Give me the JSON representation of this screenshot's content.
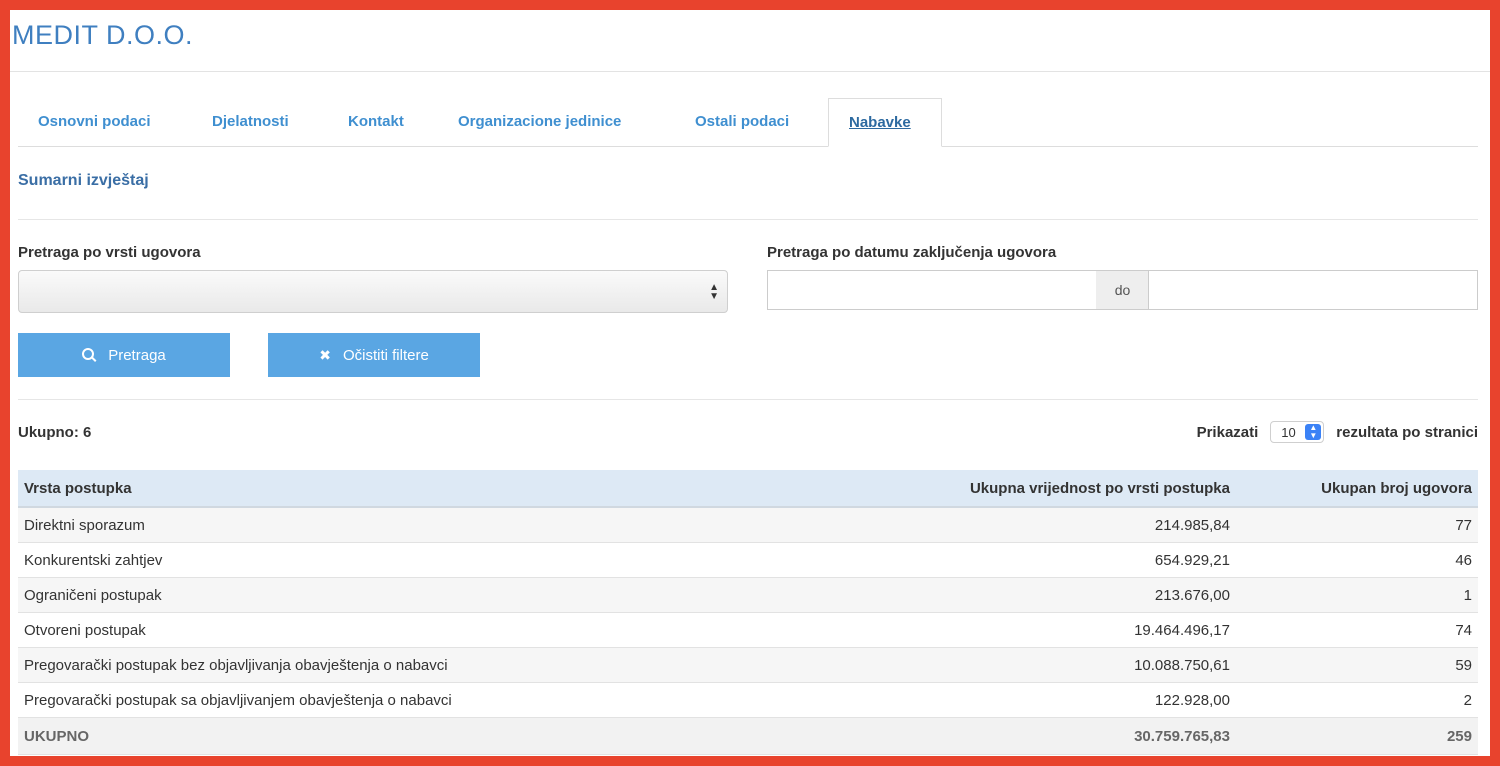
{
  "company": {
    "title": "MEDIT D.O.O."
  },
  "tabs": [
    {
      "label": "Osnovni podaci",
      "active": false
    },
    {
      "label": "Djelatnosti",
      "active": false
    },
    {
      "label": "Kontakt",
      "active": false
    },
    {
      "label": "Organizacione jedinice",
      "active": false
    },
    {
      "label": "Ostali podaci",
      "active": false
    },
    {
      "label": "Nabavke",
      "active": true
    }
  ],
  "section": {
    "title": "Sumarni izvještaj"
  },
  "filters": {
    "contract_type_label": "Pretraga po vrsti ugovora",
    "contract_type_value": "",
    "date_label": "Pretraga po datumu zaključenja ugovora",
    "date_from": "",
    "date_separator": "do",
    "date_to": ""
  },
  "buttons": {
    "search_label": "Pretraga",
    "clear_label": "Očistiti filtere"
  },
  "summary": {
    "total_label": "Ukupno: 6",
    "show_label": "Prikazati",
    "page_size": "10",
    "per_page_label": "rezultata po stranici"
  },
  "table": {
    "columns": [
      "Vrsta postupka",
      "Ukupna vrijednost po vrsti postupka",
      "Ukupan broj ugovora"
    ],
    "rows": [
      [
        "Direktni sporazum",
        "214.985,84",
        "77"
      ],
      [
        "Konkurentski zahtjev",
        "654.929,21",
        "46"
      ],
      [
        "Ograničeni postupak",
        "213.676,00",
        "1"
      ],
      [
        "Otvoreni postupak",
        "19.464.496,17",
        "74"
      ],
      [
        "Pregovarački postupak bez objavljivanja obavještenja o nabavci",
        "10.088.750,61",
        "59"
      ],
      [
        "Pregovarački postupak sa objavljivanjem obavještenja o nabavci",
        "122.928,00",
        "2"
      ]
    ],
    "total": [
      "UKUPNO",
      "30.759.765,83",
      "259"
    ]
  },
  "colors": {
    "accent": "#5aa6e3",
    "link": "#3f8fd0",
    "frame": "#e8432d"
  },
  "icons": {
    "search": "search-icon",
    "clear": "close-icon"
  }
}
